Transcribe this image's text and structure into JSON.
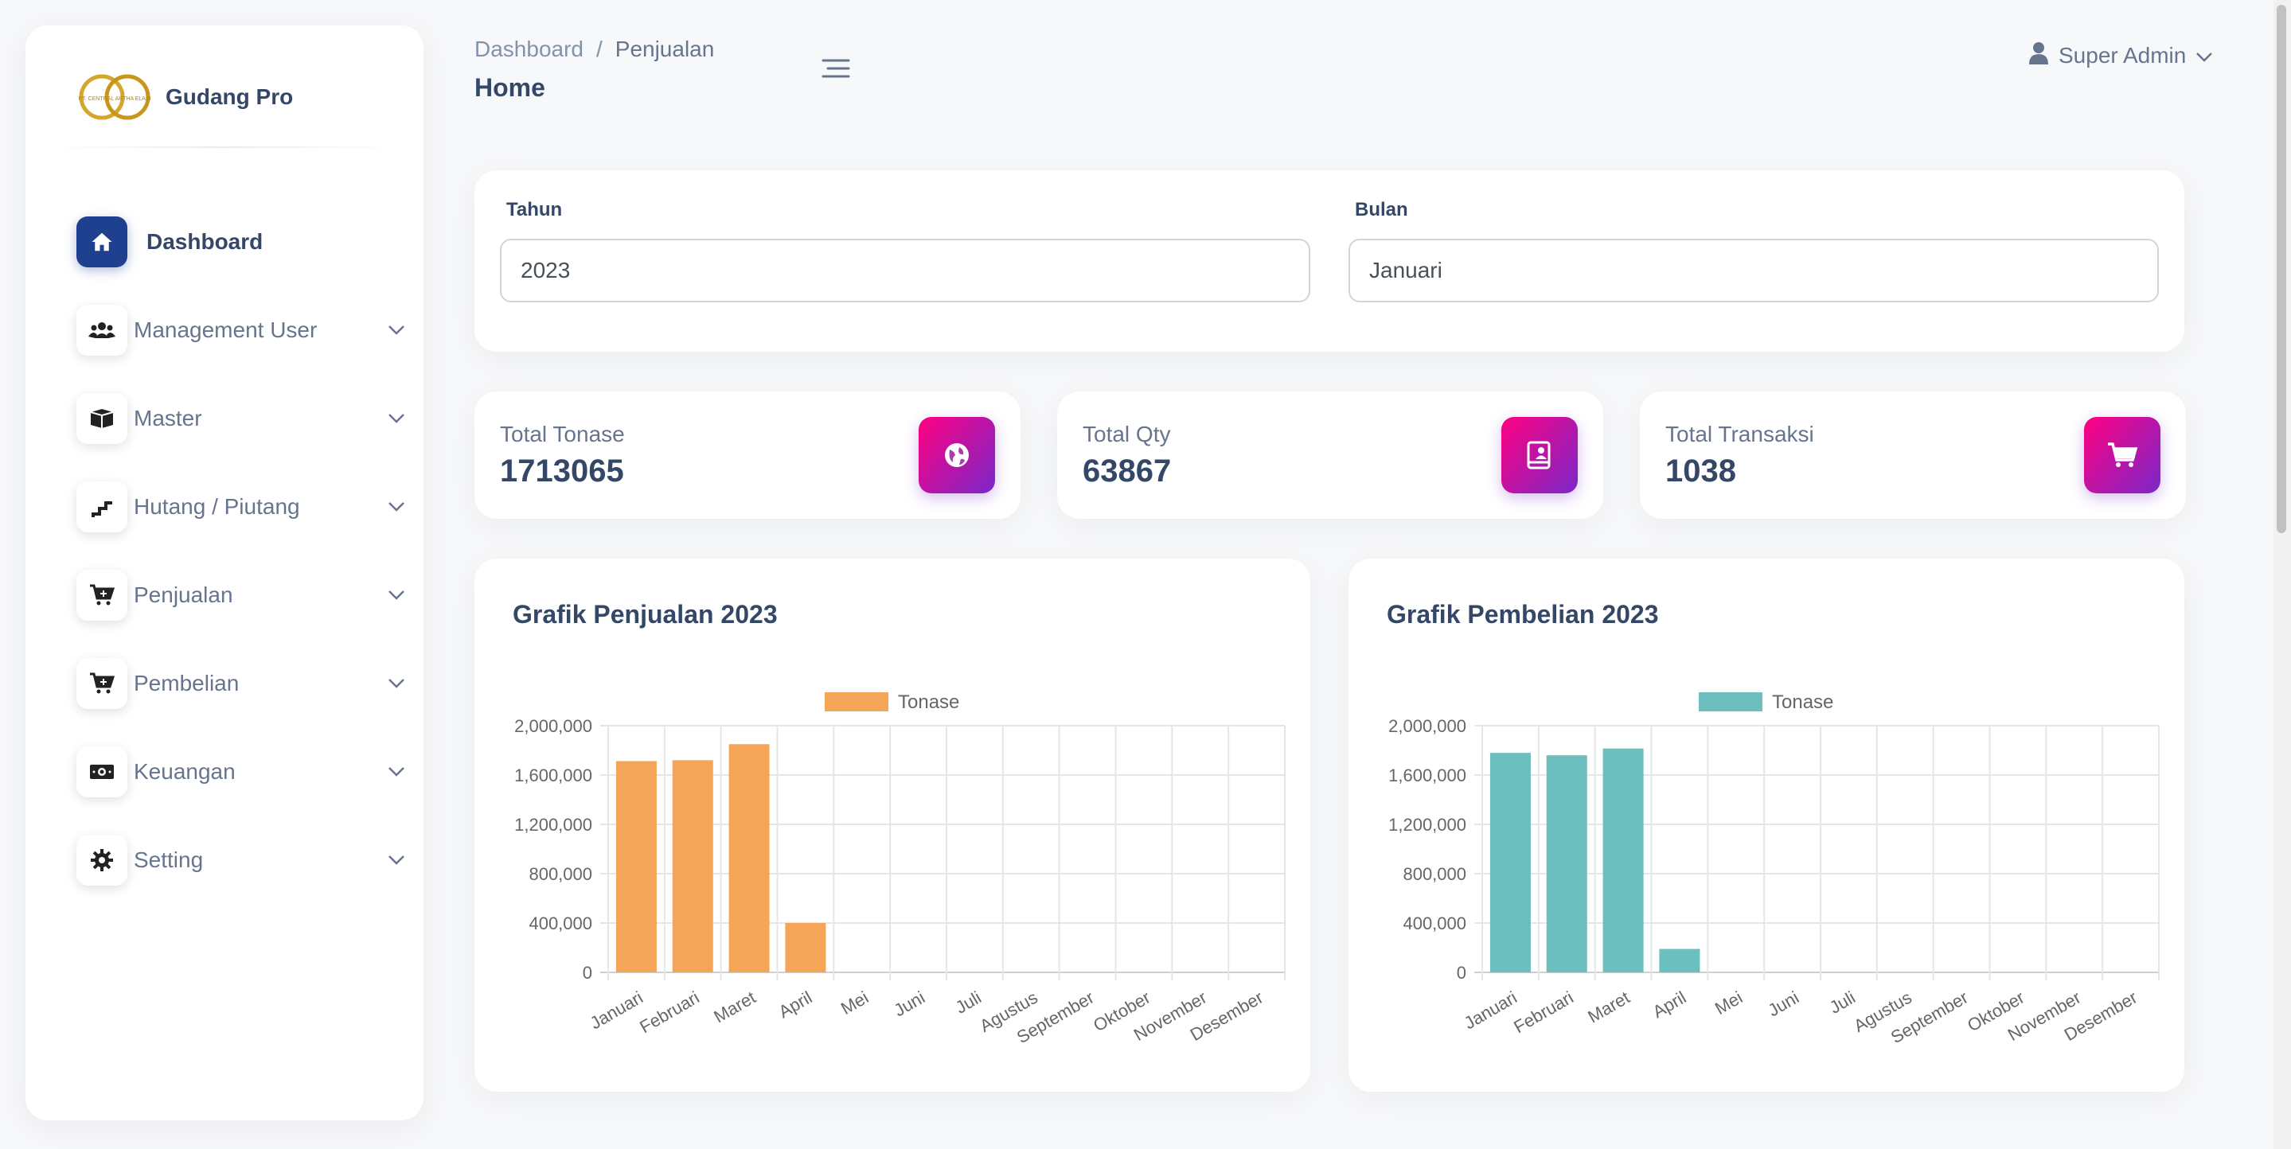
{
  "brand": {
    "name": "Gudang Pro",
    "logo_text": "PT. CENTRAL ARTHA ELASI"
  },
  "sidebar": {
    "items": [
      {
        "label": "Dashboard",
        "icon": "home-icon",
        "active": true
      },
      {
        "label": "Management User",
        "icon": "users-icon"
      },
      {
        "label": "Master",
        "icon": "box-icon"
      },
      {
        "label": "Hutang / Piutang",
        "icon": "stairs-icon"
      },
      {
        "label": "Penjualan",
        "icon": "cart-plus-icon"
      },
      {
        "label": "Pembelian",
        "icon": "cart-plus-icon"
      },
      {
        "label": "Keuangan",
        "icon": "money-icon"
      },
      {
        "label": "Setting",
        "icon": "gear-icon"
      }
    ]
  },
  "header": {
    "breadcrumb": [
      "Dashboard",
      "/",
      "Penjualan"
    ],
    "title": "Home",
    "user": "Super Admin"
  },
  "filters": {
    "year_label": "Tahun",
    "year_value": "2023",
    "month_label": "Bulan",
    "month_value": "Januari"
  },
  "stats": [
    {
      "label": "Total Tonase",
      "value": "1713065",
      "icon": "globe-icon"
    },
    {
      "label": "Total Qty",
      "value": "63867",
      "icon": "report-icon"
    },
    {
      "label": "Total Transaksi",
      "value": "1038",
      "icon": "cart-icon"
    }
  ],
  "colors": {
    "accent": "#1f3f8f",
    "stat_gradient_start": "#7928ca",
    "stat_gradient_end": "#ff0080",
    "sales_bar": "#f4a557",
    "purchase_bar": "#6cbfbf"
  },
  "chart_data": [
    {
      "type": "bar",
      "title": "Grafik Penjualan 2023",
      "categories": [
        "Januari",
        "Februari",
        "Maret",
        "April",
        "Mei",
        "Juni",
        "Juli",
        "Agustus",
        "September",
        "Oktober",
        "November",
        "Desember"
      ],
      "series": [
        {
          "name": "Tonase",
          "values": [
            1713065,
            1720000,
            1850000,
            400000,
            0,
            0,
            0,
            0,
            0,
            0,
            0,
            0
          ]
        }
      ],
      "ylim": [
        0,
        2000000
      ],
      "yticks": [
        "0",
        "400,000",
        "800,000",
        "1,200,000",
        "1,600,000",
        "2,000,000"
      ],
      "grid": true,
      "legend": "top-center",
      "color": "#f4a557"
    },
    {
      "type": "bar",
      "title": "Grafik Pembelian 2023",
      "categories": [
        "Januari",
        "Februari",
        "Maret",
        "April",
        "Mei",
        "Juni",
        "Juli",
        "Agustus",
        "September",
        "Oktober",
        "November",
        "Desember"
      ],
      "series": [
        {
          "name": "Tonase",
          "values": [
            1780000,
            1760000,
            1815000,
            190000,
            0,
            0,
            0,
            0,
            0,
            0,
            0,
            0
          ]
        }
      ],
      "ylim": [
        0,
        2000000
      ],
      "yticks": [
        "0",
        "400,000",
        "800,000",
        "1,200,000",
        "1,600,000",
        "2,000,000"
      ],
      "grid": true,
      "legend": "top-center",
      "color": "#6cbfbf"
    }
  ]
}
